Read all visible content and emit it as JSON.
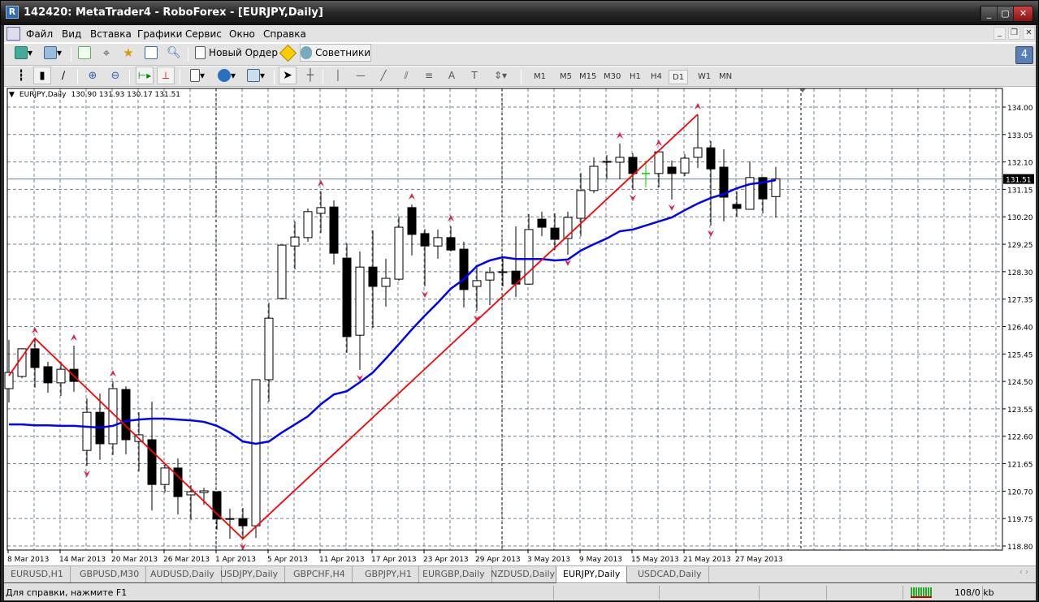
{
  "window": {
    "title": "142420: MetaTrader4 - RoboForex - [EURJPY,Daily]",
    "app_icon": "metatrader-icon"
  },
  "menu": [
    "Файл",
    "Вид",
    "Вставка",
    "Графики",
    "Сервис",
    "Окно",
    "Справка"
  ],
  "toolbar1": {
    "new_order": "Новый Ордер",
    "experts": "Советники"
  },
  "toolbar2": {
    "draw_tools": [
      "cursor-icon",
      "crosshair-icon",
      "vertical-line-icon",
      "horizontal-line-icon",
      "trendline-icon",
      "equidistant-channel-icon",
      "fibonacci-icon",
      "text-icon",
      "text-label-icon",
      "arrows-icon"
    ],
    "timeframes": [
      "M1",
      "M5",
      "M15",
      "M30",
      "H1",
      "H4",
      "D1",
      "W1",
      "MN"
    ],
    "active_timeframe": "D1"
  },
  "notifications": {
    "count": "4"
  },
  "chart": {
    "header": "EURJPY,Daily",
    "ohlc": "130.90 131.93 130.17 131.51",
    "current_price": "131.51",
    "colors": {
      "bull_body": "#ffffff",
      "bear_body": "#000000",
      "ma": "#0000ff",
      "zigzag": "#ff0000",
      "fractal": "#e0204a",
      "doji_highlight": "#00d000",
      "grid": "#708090"
    }
  },
  "chart_data": {
    "type": "candlestick",
    "symbol": "EURJPY",
    "timeframe": "Daily",
    "ylim": [
      118.8,
      134.0
    ],
    "y_ticks": [
      "134.00",
      "133.05",
      "132.10",
      "131.15",
      "130.20",
      "129.25",
      "128.30",
      "127.35",
      "126.40",
      "125.45",
      "124.50",
      "123.55",
      "122.60",
      "121.65",
      "120.70",
      "119.75",
      "118.80"
    ],
    "x_ticks": [
      {
        "bar": 0,
        "label": "8 Mar 2013"
      },
      {
        "bar": 4,
        "label": "14 Mar 2013"
      },
      {
        "bar": 8,
        "label": "20 Mar 2013"
      },
      {
        "bar": 12,
        "label": "26 Mar 2013"
      },
      {
        "bar": 16,
        "label": "1 Apr 2013"
      },
      {
        "bar": 20,
        "label": "5 Apr 2013"
      },
      {
        "bar": 24,
        "label": "11 Apr 2013"
      },
      {
        "bar": 28,
        "label": "17 Apr 2013"
      },
      {
        "bar": 32,
        "label": "23 Apr 2013"
      },
      {
        "bar": 36,
        "label": "29 Apr 2013"
      },
      {
        "bar": 40,
        "label": "3 May 2013"
      },
      {
        "bar": 44,
        "label": "9 May 2013"
      },
      {
        "bar": 48,
        "label": "15 May 2013"
      },
      {
        "bar": 52,
        "label": "21 May 2013"
      },
      {
        "bar": 56,
        "label": "27 May 2013"
      }
    ],
    "grid": true,
    "ohlc": [
      [
        124.25,
        125.94,
        123.77,
        124.81
      ],
      [
        124.67,
        125.65,
        124.61,
        125.63
      ],
      [
        125.63,
        125.99,
        124.28,
        124.98
      ],
      [
        125.01,
        125.18,
        124.11,
        124.45
      ],
      [
        124.45,
        125.18,
        124.0,
        124.92
      ],
      [
        124.92,
        125.74,
        124.14,
        124.5
      ],
      [
        122.11,
        123.91,
        121.58,
        123.43
      ],
      [
        123.43,
        124.08,
        121.78,
        122.34
      ],
      [
        122.34,
        124.5,
        121.95,
        124.25
      ],
      [
        124.22,
        124.33,
        121.97,
        122.48
      ],
      [
        122.42,
        123.43,
        121.38,
        122.65
      ],
      [
        122.48,
        123.8,
        120.03,
        120.93
      ],
      [
        120.93,
        121.61,
        120.65,
        121.5
      ],
      [
        121.5,
        121.83,
        119.89,
        120.51
      ],
      [
        120.57,
        120.91,
        119.7,
        120.68
      ],
      [
        120.65,
        120.82,
        120.23,
        120.71
      ],
      [
        120.68,
        120.68,
        119.36,
        119.73
      ],
      [
        119.73,
        120.09,
        119.05,
        119.75
      ],
      [
        119.75,
        120.12,
        119.05,
        119.5
      ],
      [
        119.5,
        124.56,
        119.08,
        124.56
      ],
      [
        124.56,
        127.23,
        123.8,
        126.69
      ],
      [
        127.37,
        129.22,
        127.34,
        129.22
      ],
      [
        129.19,
        130.04,
        128.38,
        129.5
      ],
      [
        129.48,
        130.49,
        129.34,
        130.38
      ],
      [
        130.32,
        131.08,
        129.64,
        130.52
      ],
      [
        130.54,
        130.77,
        128.55,
        128.94
      ],
      [
        128.77,
        129.28,
        125.49,
        126.05
      ],
      [
        126.1,
        129.0,
        124.9,
        128.46
      ],
      [
        128.46,
        129.73,
        126.36,
        127.79
      ],
      [
        127.79,
        128.75,
        127.09,
        128.07
      ],
      [
        128.04,
        130.21,
        127.99,
        129.84
      ],
      [
        130.52,
        130.63,
        128.86,
        129.59
      ],
      [
        129.62,
        129.78,
        127.79,
        129.19
      ],
      [
        129.19,
        129.76,
        128.75,
        129.48
      ],
      [
        129.48,
        129.87,
        129.0,
        129.05
      ],
      [
        129.08,
        129.34,
        127.06,
        127.68
      ],
      [
        127.79,
        128.46,
        126.95,
        127.99
      ],
      [
        128.01,
        128.46,
        127.14,
        128.27
      ],
      [
        128.27,
        128.77,
        127.79,
        128.3
      ],
      [
        128.32,
        129.87,
        127.42,
        127.87
      ],
      [
        127.87,
        130.29,
        127.85,
        129.76
      ],
      [
        130.12,
        130.38,
        129.53,
        129.84
      ],
      [
        129.81,
        130.32,
        129.05,
        129.42
      ],
      [
        129.45,
        130.38,
        128.89,
        130.18
      ],
      [
        130.15,
        131.72,
        129.53,
        131.11
      ],
      [
        131.11,
        132.26,
        131.02,
        131.95
      ],
      [
        132.09,
        132.34,
        131.5,
        132.12
      ],
      [
        132.09,
        132.74,
        131.5,
        132.26
      ],
      [
        132.26,
        132.4,
        131.13,
        131.7
      ],
      [
        131.7,
        132.15,
        131.22,
        131.7
      ],
      [
        131.7,
        132.48,
        131.22,
        132.45
      ],
      [
        131.92,
        132.15,
        130.8,
        131.7
      ],
      [
        131.72,
        132.37,
        131.61,
        132.23
      ],
      [
        132.26,
        133.75,
        131.89,
        132.59
      ],
      [
        132.59,
        132.82,
        129.9,
        131.86
      ],
      [
        131.92,
        132.54,
        130.04,
        130.88
      ],
      [
        130.63,
        131.08,
        130.21,
        130.49
      ],
      [
        130.46,
        132.12,
        130.46,
        131.56
      ],
      [
        131.56,
        131.58,
        130.32,
        130.82
      ],
      [
        130.9,
        131.93,
        130.17,
        131.51
      ]
    ],
    "moving_average": [
      123.01,
      123.01,
      122.98,
      122.98,
      122.96,
      122.96,
      122.93,
      122.9,
      122.96,
      123.13,
      123.18,
      123.21,
      123.21,
      123.18,
      123.15,
      123.1,
      122.96,
      122.73,
      122.42,
      122.34,
      122.42,
      122.73,
      123.01,
      123.29,
      123.71,
      124.05,
      124.16,
      124.47,
      124.81,
      125.29,
      125.79,
      126.3,
      126.78,
      127.23,
      127.71,
      128.04,
      128.49,
      128.69,
      128.8,
      128.74,
      128.74,
      128.74,
      128.69,
      128.72,
      129.03,
      129.25,
      129.45,
      129.7,
      129.76,
      129.9,
      130.04,
      130.18,
      130.43,
      130.66,
      130.85,
      130.99,
      131.19,
      131.33,
      131.39,
      131.47
    ],
    "zigzag": [
      {
        "bar": 0,
        "price": 124.7
      },
      {
        "bar": 2,
        "price": 125.99
      },
      {
        "bar": 18,
        "price": 119.05
      },
      {
        "bar": 53,
        "price": 133.75
      }
    ],
    "fractals_up": [
      2,
      5,
      8,
      24,
      31,
      34,
      47,
      50,
      53
    ],
    "fractals_down": [
      6,
      18,
      27,
      32,
      36,
      43,
      48,
      51,
      54
    ],
    "period_separators": [
      16,
      38
    ]
  },
  "tabs": {
    "items": [
      "EURUSD,H1",
      "GBPUSD,M30",
      "AUDUSD,Daily",
      "USDJPY,Daily",
      "GBPCHF,H4",
      "GBPJPY,H1",
      "EURGBP,Daily",
      "NZDUSD,Daily",
      "EURJPY,Daily",
      "USDCAD,Daily"
    ],
    "active": "EURJPY,Daily"
  },
  "status": {
    "help": "Для справки, нажмите F1",
    "traffic": "108/0 kb"
  }
}
